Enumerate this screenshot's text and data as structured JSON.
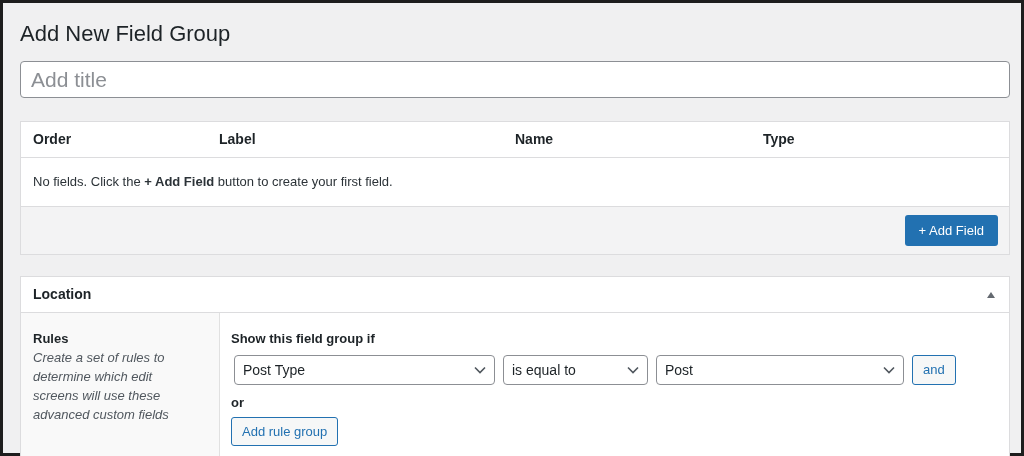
{
  "page_title": "Add New Field Group",
  "title_field": {
    "placeholder": "Add title"
  },
  "fields_table": {
    "columns": [
      "Order",
      "Label",
      "Name",
      "Type"
    ],
    "empty_message": "No fields. Click the **+ Add Field** button to create your first field.",
    "add_button": "+ Add Field"
  },
  "location": {
    "title": "Location",
    "expanded": true,
    "rules_label": "Rules",
    "rules_description": "Create a set of rules to determine which edit screens will use these advanced custom fields",
    "condition_label": "Show this field group if",
    "rules": [
      {
        "param": "Post Type",
        "operator": "is equal to",
        "value": "Post",
        "and_button": "and"
      }
    ],
    "or_label": "or",
    "add_rule_group_button": "Add rule group"
  }
}
